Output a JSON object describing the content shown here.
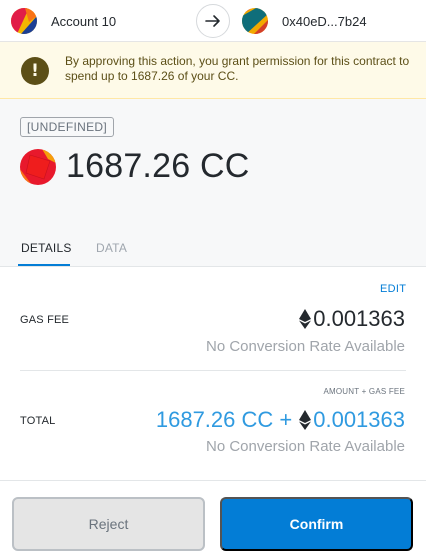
{
  "header": {
    "from_account_name": "Account 10",
    "to_contract_address": "0x40eD...7b24",
    "from_avatar_icon": "account-avatar-icon",
    "arrow_icon": "arrow-right-icon",
    "to_avatar_icon": "contract-avatar-icon"
  },
  "warning": {
    "icon": "exclamation-icon",
    "text": "By approving this action, you grant permission for this contract to spend up to 1687.26 of your CC."
  },
  "summary": {
    "method": "[UNDEFINED]",
    "token_icon": "token-icon",
    "amount": "1687.26 CC"
  },
  "tabs": [
    {
      "label": "DETAILS",
      "active": true
    },
    {
      "label": "DATA",
      "active": false
    }
  ],
  "details": {
    "edit_label": "EDIT",
    "gas_fee_label": "GAS FEE",
    "gas_fee_value": "0.001363",
    "gas_fee_conversion": "No Conversion Rate Available",
    "total_sublabel": "AMOUNT + GAS FEE",
    "total_label": "TOTAL",
    "total_amount_prefix": "1687.26 CC +",
    "total_eth_value": "0.001363",
    "total_conversion": "No Conversion Rate Available"
  },
  "footer": {
    "reject_label": "Reject",
    "confirm_label": "Confirm"
  },
  "colors": {
    "accent": "#037dd6",
    "total_blue": "#2f9ae0",
    "warning_bg": "#fefae8",
    "warning_text": "#5c4f17"
  }
}
